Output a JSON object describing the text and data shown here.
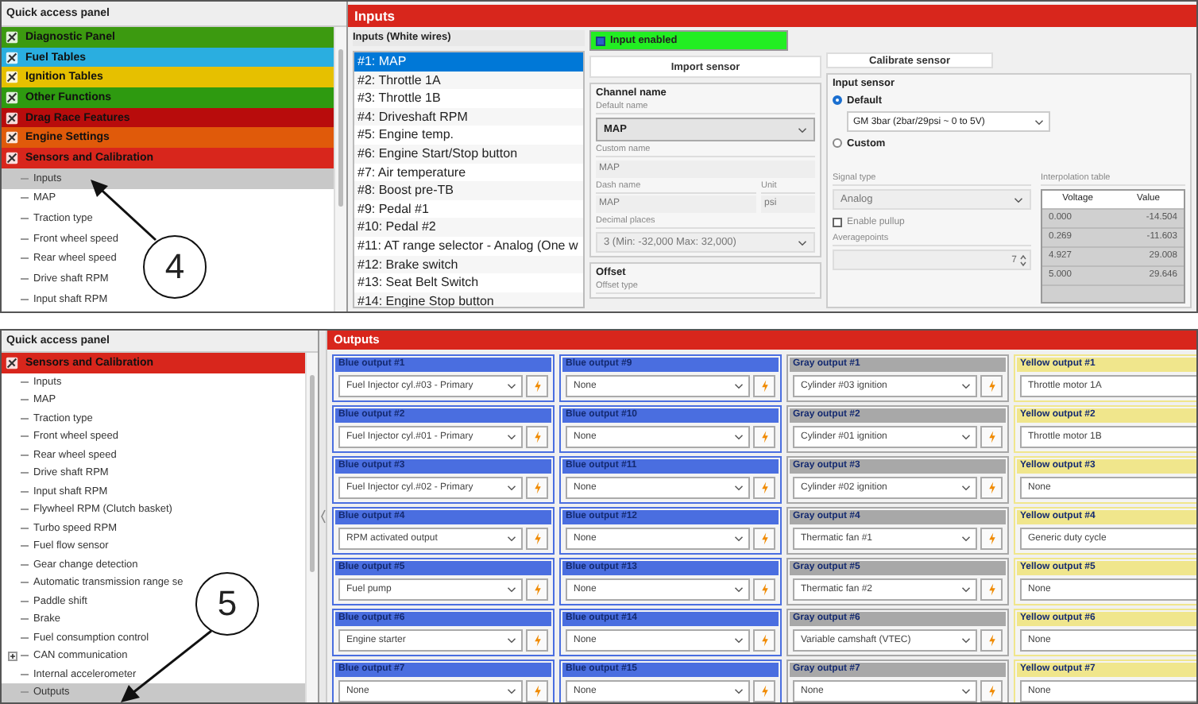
{
  "top": {
    "sidebar": {
      "title": "Quick access panel",
      "categories": [
        {
          "label": "Diagnostic Panel",
          "color": "#3c9a10"
        },
        {
          "label": "Fuel Tables",
          "color": "#2aaee0"
        },
        {
          "label": "Ignition Tables",
          "color": "#e6c000"
        },
        {
          "label": "Other Functions",
          "color": "#2e9a10"
        },
        {
          "label": "Drag Race Features",
          "color": "#b80c0c"
        },
        {
          "label": "Engine Settings",
          "color": "#e05a0a"
        },
        {
          "label": "Sensors and Calibration",
          "color": "#d8261c"
        }
      ],
      "items": [
        {
          "label": "Inputs",
          "selected": true,
          "kind": "leaf"
        },
        {
          "label": "MAP",
          "selected": false,
          "kind": "leaf"
        },
        {
          "label": "Traction type",
          "selected": false,
          "kind": "leaf"
        },
        {
          "label": "Front wheel speed",
          "selected": false,
          "kind": "leaf"
        },
        {
          "label": "Rear wheel speed",
          "selected": false,
          "kind": "leaf"
        },
        {
          "label": "Drive shaft RPM",
          "selected": false,
          "kind": "leaf"
        },
        {
          "label": "Input shaft RPM",
          "selected": false,
          "kind": "leaf"
        }
      ]
    },
    "callout": "4",
    "panel": {
      "title": "Inputs",
      "list_title": "Inputs (White wires)",
      "inputs": [
        {
          "label": "#1: MAP",
          "selected": true
        },
        {
          "label": "#2: Throttle 1A",
          "selected": false
        },
        {
          "label": "#3: Throttle 1B",
          "selected": false
        },
        {
          "label": "#4: Driveshaft RPM",
          "selected": false
        },
        {
          "label": "#5: Engine temp.",
          "selected": false
        },
        {
          "label": "#6: Engine Start/Stop button",
          "selected": false
        },
        {
          "label": "#7: Air temperature",
          "selected": false
        },
        {
          "label": "#8: Boost pre-TB",
          "selected": false
        },
        {
          "label": "#9: Pedal #1",
          "selected": false
        },
        {
          "label": "#10: Pedal #2",
          "selected": false
        },
        {
          "label": "#11: AT range selector - Analog (One w",
          "selected": false
        },
        {
          "label": "#12: Brake switch",
          "selected": false
        },
        {
          "label": "#13: Seat Belt Switch",
          "selected": false
        },
        {
          "label": "#14: Engine Stop button",
          "selected": false
        }
      ],
      "input_enabled": {
        "label": "Input enabled",
        "checked": true
      },
      "import_button": "Import sensor",
      "calibrate_button": "Calibrate sensor",
      "channel_name": {
        "title": "Channel name",
        "default_name": {
          "label": "Default name",
          "value": "MAP",
          "disabled": false
        },
        "custom_name": {
          "label": "Custom name",
          "value": "MAP",
          "disabled": true
        },
        "dash_name": {
          "label": "Dash name",
          "value": "MAP",
          "disabled": true
        },
        "unit": {
          "label": "Unit",
          "value": "psi",
          "disabled": true
        },
        "decimal_places": {
          "label": "Decimal places",
          "value": "3 (Min: -32,000 Max: 32,000)",
          "disabled": true
        }
      },
      "offset": {
        "title": "Offset",
        "type_label": "Offset type"
      },
      "input_sensor": {
        "title": "Input sensor",
        "options": [
          {
            "label": "Default",
            "selected": true
          },
          {
            "label": "Custom",
            "selected": false
          }
        ],
        "sensor_select": "GM 3bar (2bar/29psi ~ 0 to 5V)",
        "signal_type": {
          "label": "Signal type",
          "value": "Analog"
        },
        "pullup": {
          "label": "Enable pullup",
          "checked": false
        },
        "averagepoints": {
          "label": "Averagepoints",
          "value": "7"
        }
      },
      "interpolation": {
        "title": "Interpolation table",
        "columns": [
          "Voltage",
          "Value"
        ],
        "rows": [
          [
            "0.000",
            "-14.504"
          ],
          [
            "0.269",
            "-11.603"
          ],
          [
            "4.927",
            "29.008"
          ],
          [
            "5.000",
            "29.646"
          ]
        ]
      }
    }
  },
  "bottom": {
    "sidebar": {
      "title": "Quick access panel",
      "categories": [
        {
          "label": "Sensors and Calibration",
          "color": "#d8261c"
        }
      ],
      "items": [
        {
          "label": "Inputs",
          "selected": false,
          "kind": "leaf"
        },
        {
          "label": "MAP",
          "selected": false,
          "kind": "leaf"
        },
        {
          "label": "Traction type",
          "selected": false,
          "kind": "leaf"
        },
        {
          "label": "Front wheel speed",
          "selected": false,
          "kind": "leaf"
        },
        {
          "label": "Rear wheel speed",
          "selected": false,
          "kind": "leaf"
        },
        {
          "label": "Drive shaft RPM",
          "selected": false,
          "kind": "leaf"
        },
        {
          "label": "Input shaft RPM",
          "selected": false,
          "kind": "leaf"
        },
        {
          "label": "Flywheel RPM (Clutch basket)",
          "selected": false,
          "kind": "leaf"
        },
        {
          "label": "Turbo speed RPM",
          "selected": false,
          "kind": "leaf"
        },
        {
          "label": "Fuel flow sensor",
          "selected": false,
          "kind": "leaf"
        },
        {
          "label": "Gear change detection",
          "selected": false,
          "kind": "leaf"
        },
        {
          "label": "Automatic transmission range se",
          "selected": false,
          "kind": "leaf"
        },
        {
          "label": "Paddle shift",
          "selected": false,
          "kind": "leaf"
        },
        {
          "label": "Brake",
          "selected": false,
          "kind": "leaf"
        },
        {
          "label": "Fuel consumption control",
          "selected": false,
          "kind": "leaf"
        },
        {
          "label": "CAN communication",
          "selected": false,
          "kind": "branch"
        },
        {
          "label": "Internal accelerometer",
          "selected": false,
          "kind": "leaf"
        },
        {
          "label": "Outputs",
          "selected": true,
          "kind": "leaf"
        }
      ]
    },
    "callout": "5",
    "panel": {
      "title": "Outputs",
      "groups": [
        {
          "color": "#4a6ee0",
          "flash_button": true,
          "outputs": [
            {
              "title": "Blue output #1",
              "value": "Fuel Injector cyl.#03 - Primary"
            },
            {
              "title": "Blue output #2",
              "value": "Fuel Injector cyl.#01 - Primary"
            },
            {
              "title": "Blue output #3",
              "value": "Fuel Injector cyl.#02 - Primary"
            },
            {
              "title": "Blue output #4",
              "value": "RPM activated output"
            },
            {
              "title": "Blue output #5",
              "value": "Fuel pump"
            },
            {
              "title": "Blue output #6",
              "value": "Engine starter"
            },
            {
              "title": "Blue output #7",
              "value": "None"
            }
          ]
        },
        {
          "color": "#4a6ee0",
          "flash_button": true,
          "outputs": [
            {
              "title": "Blue output #9",
              "value": "None"
            },
            {
              "title": "Blue output #10",
              "value": "None"
            },
            {
              "title": "Blue output #11",
              "value": "None"
            },
            {
              "title": "Blue output #12",
              "value": "None"
            },
            {
              "title": "Blue output #13",
              "value": "None"
            },
            {
              "title": "Blue output #14",
              "value": "None"
            },
            {
              "title": "Blue output #15",
              "value": "None"
            }
          ]
        },
        {
          "color": "#a8a8a8",
          "flash_button": true,
          "outputs": [
            {
              "title": "Gray output #1",
              "value": "Cylinder #03 ignition"
            },
            {
              "title": "Gray output #2",
              "value": "Cylinder #01 ignition"
            },
            {
              "title": "Gray output #3",
              "value": "Cylinder #02 ignition"
            },
            {
              "title": "Gray output #4",
              "value": "Thermatic fan #1"
            },
            {
              "title": "Gray output #5",
              "value": "Thermatic fan #2"
            },
            {
              "title": "Gray output #6",
              "value": "Variable camshaft (VTEC)"
            },
            {
              "title": "Gray output #7",
              "value": "None"
            }
          ]
        },
        {
          "color": "#f0e68c",
          "flash_button": false,
          "outputs": [
            {
              "title": "Yellow output #1",
              "value": "Throttle motor 1A"
            },
            {
              "title": "Yellow output #2",
              "value": "Throttle motor 1B"
            },
            {
              "title": "Yellow output #3",
              "value": "None"
            },
            {
              "title": "Yellow output #4",
              "value": "Generic duty cycle"
            },
            {
              "title": "Yellow output #5",
              "value": "None"
            },
            {
              "title": "Yellow output #6",
              "value": "None"
            },
            {
              "title": "Yellow output #7",
              "value": "None"
            }
          ]
        }
      ]
    }
  }
}
